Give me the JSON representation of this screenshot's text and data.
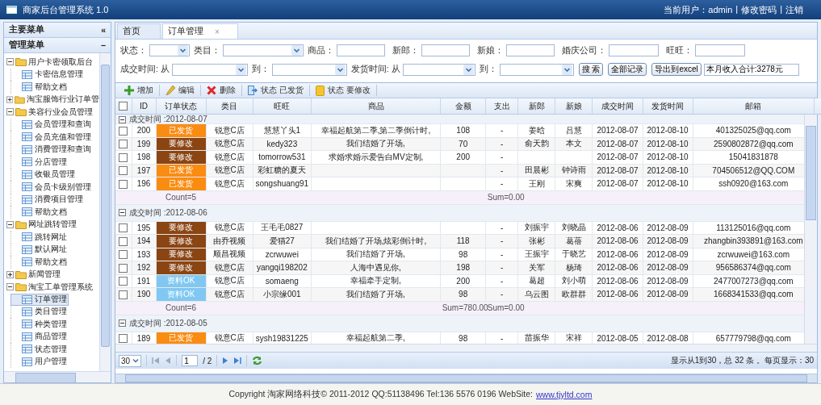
{
  "header": {
    "title": "商家后台管理系统 1.0",
    "user": "当前用户：admin",
    "separator": "|",
    "links": [
      "修改密码",
      "注销"
    ]
  },
  "sidebar": {
    "title": "主要菜单",
    "collapse": "«",
    "section": "管理菜单",
    "section_toggle": "−",
    "tree": [
      {
        "label": "用户卡密领取后台",
        "expanded": true,
        "children": [
          {
            "label": "卡密信息管理",
            "selected": false
          },
          {
            "label": "帮助文档",
            "selected": false
          }
        ]
      },
      {
        "label": "淘宝服饰行业订单管",
        "expanded": false
      },
      {
        "label": "美容行业会员管理",
        "expanded": true,
        "children": [
          {
            "label": "会员管理和查询",
            "selected": false
          },
          {
            "label": "会员充值和管理",
            "selected": false
          },
          {
            "label": "消费管理和查询",
            "selected": false
          },
          {
            "label": "分店管理",
            "selected": false
          },
          {
            "label": "收银员管理",
            "selected": false
          },
          {
            "label": "会员卡级别管理",
            "selected": false
          },
          {
            "label": "消费项目管理",
            "selected": false
          },
          {
            "label": "帮助文档",
            "selected": false
          }
        ]
      },
      {
        "label": "网址跳转管理",
        "expanded": true,
        "children": [
          {
            "label": "跳转网址",
            "selected": false
          },
          {
            "label": "默认网址",
            "selected": false
          },
          {
            "label": "帮助文档",
            "selected": false
          }
        ]
      },
      {
        "label": "新闻管理",
        "expanded": false
      },
      {
        "label": "淘宝工单管理系统",
        "expanded": true,
        "children": [
          {
            "label": "订单管理",
            "selected": true
          },
          {
            "label": "类目管理",
            "selected": false
          },
          {
            "label": "种类管理",
            "selected": false
          },
          {
            "label": "商品管理",
            "selected": false
          },
          {
            "label": "状态管理",
            "selected": false
          },
          {
            "label": "用户管理",
            "selected": false
          }
        ]
      }
    ]
  },
  "tabs": [
    {
      "label": "首页",
      "selected": false
    },
    {
      "label": "订单管理",
      "selected": true,
      "close": "×"
    }
  ],
  "filters": [
    [
      {
        "label": "状态：",
        "kind": "select"
      },
      {
        "label": "类目：",
        "kind": "select"
      },
      {
        "label": "商品：",
        "kind": "input"
      },
      {
        "label": "新郎：",
        "kind": "input"
      },
      {
        "label": "新娘：",
        "kind": "input"
      },
      {
        "label": "婚庆公司：",
        "kind": "input"
      },
      {
        "label": "旺旺：",
        "kind": "input"
      }
    ],
    [
      {
        "label": "成交时间: 从",
        "kind": "select"
      },
      {
        "label": "到：",
        "kind": "select"
      },
      {
        "label": "发货时间: 从",
        "kind": "select"
      },
      {
        "label": "到：",
        "kind": "select"
      },
      {
        "label": "搜 索",
        "kind": "button"
      },
      {
        "label": "全部记录",
        "kind": "button"
      },
      {
        "label": "导出到excel",
        "kind": "button"
      },
      {
        "value": "本月收入合计:3278元",
        "kind": "input"
      }
    ]
  ],
  "toolbar": [
    {
      "label": "增加",
      "kind": "add"
    },
    {
      "label": "编辑",
      "kind": "edit"
    },
    {
      "label": "删除",
      "kind": "delete"
    },
    {
      "label": "状态 已发货",
      "kind": "ship"
    },
    {
      "label": "状态 要修改",
      "kind": "note"
    }
  ],
  "table": {
    "select_all": {
      "checked": false
    },
    "columns": [
      "ID",
      "订单状态",
      "类目",
      "旺旺",
      "商品",
      "金额",
      "支出",
      "新郎",
      "新娘",
      "成交时间",
      "发货时间",
      "邮箱"
    ],
    "groups": [
      {
        "header": "成交时间 :2012-08-07",
        "expanded": true,
        "rows": [
          {
            "checked": false,
            "id": "200",
            "status": {
              "text": "已发货",
              "color": "#fb8c12"
            },
            "category": "锐意C店",
            "wangwang": "慧慧丫头1",
            "goods": "幸福起航第二季,第二季倒计时,",
            "amount": "108",
            "expense": "-",
            "groom": "姜晗",
            "bride": "吕慧",
            "deal_time": "2012-08-07",
            "ship_time": "2012-08-10",
            "email": "401325025@qq.com"
          },
          {
            "checked": false,
            "id": "199",
            "status": {
              "text": "要修改",
              "color": "#8b4513"
            },
            "category": "锐意C店",
            "wangwang": "kedy323",
            "goods": "我们结婚了开场,",
            "amount": "70",
            "expense": "-",
            "groom": "俞天韵",
            "bride": "本文",
            "deal_time": "2012-08-07",
            "ship_time": "2012-08-10",
            "email": "2590802872@qq.com"
          },
          {
            "checked": false,
            "id": "198",
            "status": {
              "text": "要修改",
              "color": "#8b4513"
            },
            "category": "锐意C店",
            "wangwang": "tomorrow531",
            "goods": "求婚求婚示爱告白MV定制,",
            "amount": "200",
            "expense": "-",
            "deal_time": "2012-08-07",
            "ship_time": "2012-08-10",
            "email": "15041831878"
          },
          {
            "checked": false,
            "id": "197",
            "status": {
              "text": "已发货",
              "color": "#fb8c12"
            },
            "category": "锐意C店",
            "wangwang": "彩虹糖的夏天",
            "expense": "-",
            "groom": "田晨彬",
            "bride": "钟诗雨",
            "deal_time": "2012-08-07",
            "ship_time": "2012-08-10",
            "email": "704506512@QQ.COM"
          },
          {
            "checked": false,
            "id": "196",
            "status": {
              "text": "已发货",
              "color": "#fb8c12"
            },
            "category": "锐意C店",
            "wangwang": "songshuang91",
            "expense": "-",
            "groom": "王刚",
            "bride": "宋爽",
            "deal_time": "2012-08-07",
            "ship_time": "2012-08-10",
            "email": "ssh0920@163.com"
          }
        ],
        "summary": {
          "count": "Count=5",
          "expense_sum": "Sum=0.00"
        }
      },
      {
        "header": "成交时间 :2012-08-06",
        "expanded": true,
        "rows": [
          {
            "checked": false,
            "id": "195",
            "status": {
              "text": "要修改",
              "color": "#8b4513"
            },
            "category": "锐意C店",
            "wangwang": "王毛毛0827",
            "expense": "-",
            "groom": "刘振宇",
            "bride": "刘晓晶",
            "deal_time": "2012-08-06",
            "ship_time": "2012-08-09",
            "email": "113125016@qq.com"
          },
          {
            "checked": false,
            "id": "194",
            "status": {
              "text": "要修改",
              "color": "#8b4513"
            },
            "category": "由乔视频",
            "wangwang": "爱猫27",
            "goods": "我们结婚了开场,炫彩倒计时,",
            "amount": "118",
            "expense": "-",
            "groom": "张彬",
            "bride": "葛蓓",
            "deal_time": "2012-08-06",
            "ship_time": "2012-08-09",
            "email": "zhangbin393891@163.com"
          },
          {
            "checked": false,
            "id": "193",
            "status": {
              "text": "要修改",
              "color": "#8b4513"
            },
            "category": "顺昌视频",
            "wangwang": "zcrwuwei",
            "goods": "我们结婚了开场,",
            "amount": "98",
            "expense": "-",
            "groom": "王振宇",
            "bride": "于晓艺",
            "deal_time": "2012-08-06",
            "ship_time": "2012-08-09",
            "email": "zcrwuwei@163.com"
          },
          {
            "checked": false,
            "id": "192",
            "status": {
              "text": "要修改",
              "color": "#8b4513"
            },
            "category": "锐意C店",
            "wangwang": "yangqi198202",
            "goods": "人海中遇见你,",
            "amount": "198",
            "expense": "-",
            "groom": "关军",
            "bride": "杨琦",
            "deal_time": "2012-08-06",
            "ship_time": "2012-08-09",
            "email": "956586374@qq.com"
          },
          {
            "checked": false,
            "id": "191",
            "status": {
              "text": "资料OK",
              "color": "#80c8f2"
            },
            "category": "锐意C店",
            "wangwang": "somaeng",
            "goods": "幸福牵手定制,",
            "amount": "200",
            "expense": "-",
            "groom": "葛超",
            "bride": "刘小萌",
            "deal_time": "2012-08-06",
            "ship_time": "2012-08-09",
            "email": "2477007273@qq.com"
          },
          {
            "checked": false,
            "id": "190",
            "status": {
              "text": "资料OK",
              "color": "#80c8f2"
            },
            "category": "锐意C店",
            "wangwang": "小宗缘001",
            "goods": "我们结婚了开场,",
            "amount": "98",
            "expense": "-",
            "groom": "乌云图",
            "bride": "欧群群",
            "deal_time": "2012-08-06",
            "ship_time": "2012-08-09",
            "email": "1668341533@qq.com"
          }
        ],
        "summary": {
          "count": "Count=6",
          "amount_sum": "Sum=780.00",
          "expense_sum": "Sum=0.00"
        }
      },
      {
        "header": "成交时间 :2012-08-05",
        "expanded": true,
        "rows": [
          {
            "checked": false,
            "id": "189",
            "status": {
              "text": "已发货",
              "color": "#fb8c12"
            },
            "category": "锐意C店",
            "wangwang": "sysh19831225",
            "goods": "幸福起航第二季,",
            "amount": "98",
            "expense": "-",
            "groom": "苗振华",
            "bride": "宋祥",
            "deal_time": "2012-08-05",
            "ship_time": "2012-08-08",
            "email": "657779798@qq.com"
          }
        ]
      }
    ]
  },
  "pager": {
    "page_size": "30",
    "page": "1",
    "total_pages": "/ 2",
    "info": "显示从1到30，总 32 条 。每页显示：30"
  },
  "footer": {
    "text": "Copyright 淘家网络科技© 2011-2012 QQ:51138496 Tel:136 5576 0196 WebSite:",
    "link": "www.tjyltd.com"
  }
}
